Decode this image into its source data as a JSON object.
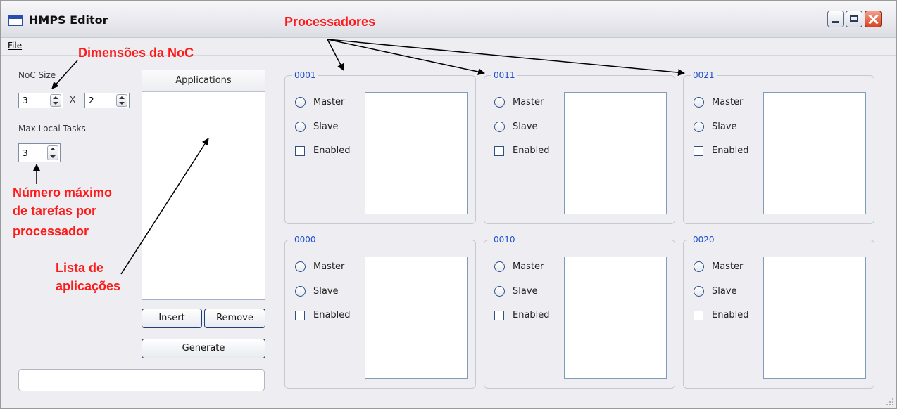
{
  "window": {
    "title": "HMPS Editor"
  },
  "menu": {
    "file": "File"
  },
  "noc": {
    "size_label": "NoC Size",
    "size_x": "3",
    "separator": "X",
    "size_y": "2",
    "max_tasks_label": "Max Local Tasks",
    "max_tasks": "3"
  },
  "applications": {
    "header": "Applications",
    "insert_label": "Insert",
    "remove_label": "Remove",
    "generate_label": "Generate"
  },
  "processors": [
    {
      "id": "0001",
      "master": "Master",
      "slave": "Slave",
      "enabled": "Enabled"
    },
    {
      "id": "0011",
      "master": "Master",
      "slave": "Slave",
      "enabled": "Enabled"
    },
    {
      "id": "0021",
      "master": "Master",
      "slave": "Slave",
      "enabled": "Enabled"
    },
    {
      "id": "0000",
      "master": "Master",
      "slave": "Slave",
      "enabled": "Enabled"
    },
    {
      "id": "0010",
      "master": "Master",
      "slave": "Slave",
      "enabled": "Enabled"
    },
    {
      "id": "0020",
      "master": "Master",
      "slave": "Slave",
      "enabled": "Enabled"
    }
  ],
  "annotations": {
    "processors": "Processadores",
    "noc_dims": "Dimensões da NoC",
    "max_tasks_1": "Número máximo",
    "max_tasks_2": "de tarefas por",
    "max_tasks_3": "processador",
    "app_list_1": "Lista de",
    "app_list_2": "aplicações",
    "color": "#ff1a1a"
  }
}
